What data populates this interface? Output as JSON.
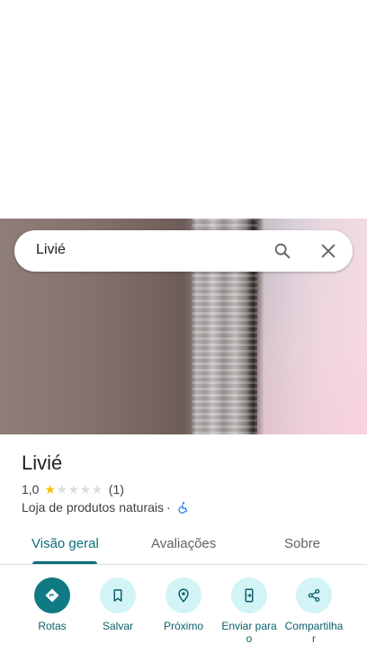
{
  "search": {
    "query": "Livié"
  },
  "place": {
    "name": "Livié",
    "rating": "1,0",
    "review_count": "(1)",
    "stars_filled": 1,
    "stars_total": 5,
    "category": "Loja de produtos naturais",
    "separator": "·",
    "accessibility_icon": "wheelchair-icon"
  },
  "tabs": [
    {
      "label": "Visão geral",
      "active": true
    },
    {
      "label": "Avaliações",
      "active": false
    },
    {
      "label": "Sobre",
      "active": false
    }
  ],
  "actions": [
    {
      "label": "Rotas",
      "icon": "directions-icon"
    },
    {
      "label": "Salvar",
      "icon": "bookmark-icon"
    },
    {
      "label": "Próximo",
      "icon": "nearby-icon"
    },
    {
      "label": "Enviar para o",
      "icon": "send-to-phone-icon"
    },
    {
      "label": "Compartilhar",
      "icon": "share-icon"
    }
  ],
  "colors": {
    "accent": "#0b6e7a",
    "primary_button": "#0f7a84",
    "button_tint": "#d2f4f6",
    "star_filled": "#fbbc04",
    "star_empty": "#dadce0"
  }
}
